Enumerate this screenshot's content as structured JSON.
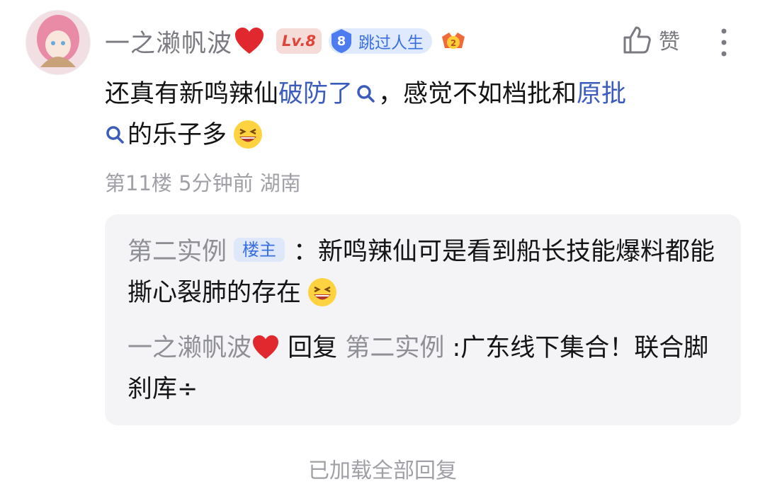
{
  "post": {
    "username": "一之濑帆波",
    "level": "Lv.8",
    "fan_level": "8",
    "fan_title": "跳过人生",
    "like_label": "赞",
    "content_parts": {
      "p1": "还真有新鸣辣仙",
      "link1": "破防了",
      "p2": "，感觉不如档批和",
      "link2": "原批",
      "p3": "的乐子多"
    },
    "meta": "第11楼 5分钟前 湖南"
  },
  "replies": [
    {
      "author": "第二实例",
      "tag": "楼主",
      "text": "：新鸣辣仙可是看到船长技能爆料都能撕心裂肺的存在"
    },
    {
      "author": "一之濑帆波",
      "reply_word": "回复",
      "target": "第二实例",
      "text": ":广东线下集合！联合脚刹库÷"
    }
  ],
  "footer_text": "已加载全部回复",
  "colors": {
    "link": "#3b5bbd",
    "level_bg": "#f6dcd8",
    "level_fg": "#e0453a",
    "fan_bg": "#dfeaff",
    "reply_bg": "#f4f4f7"
  },
  "icons": [
    "avatar",
    "heart-icon",
    "fan-shield-icon",
    "medal-icon",
    "thumbs-up-icon",
    "more-vertical-icon",
    "search-icon",
    "grin-emoji-icon"
  ]
}
